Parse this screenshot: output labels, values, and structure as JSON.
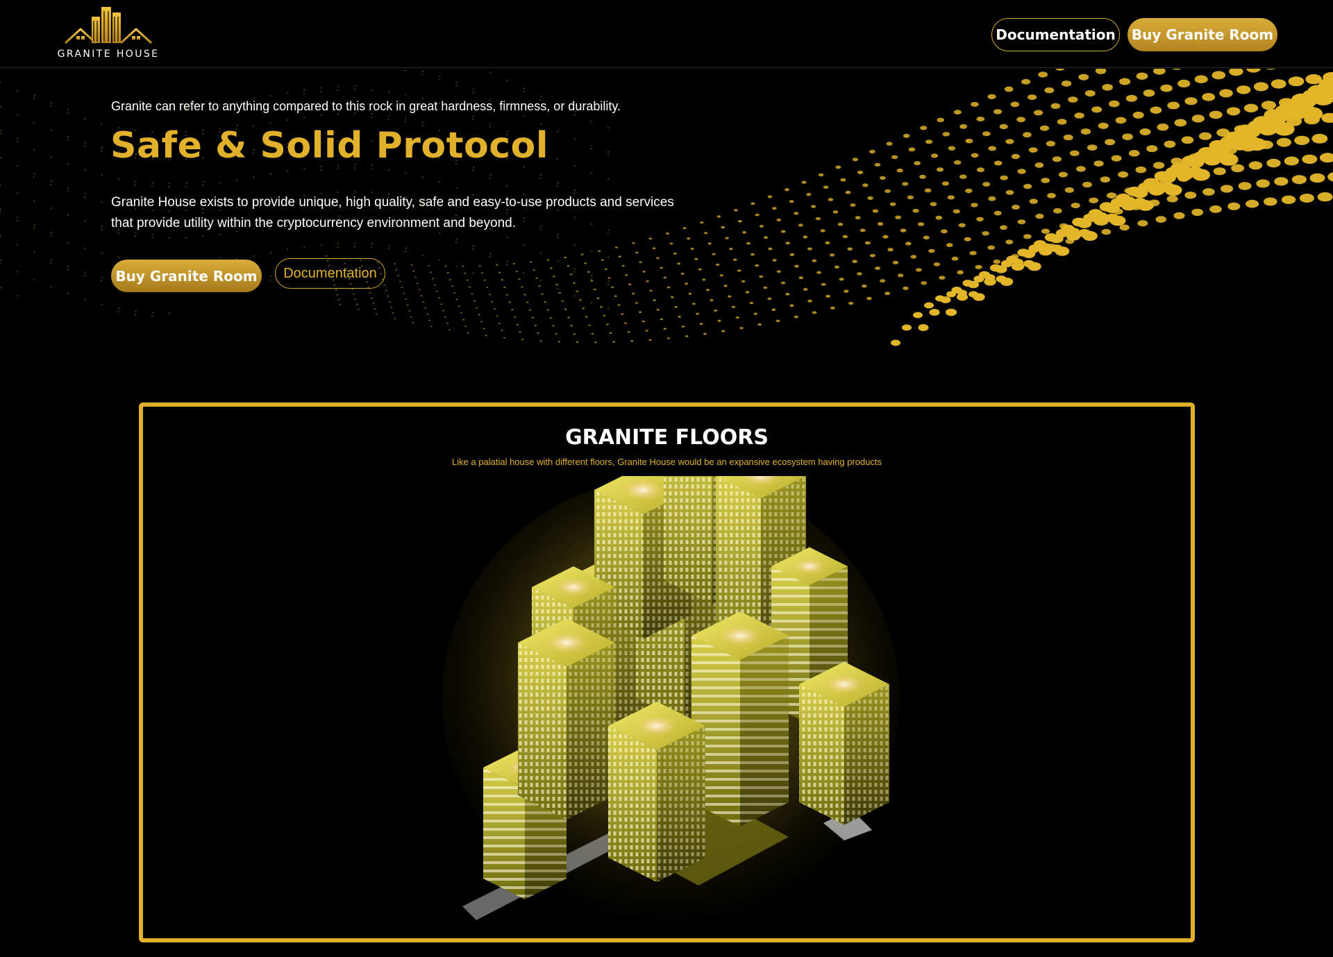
{
  "brand": {
    "name": "GRANITE HOUSE"
  },
  "nav": {
    "documentation_label": "Documentation",
    "buy_label": "Buy Granite Room"
  },
  "hero": {
    "tagline": "Granite can refer to anything compared to this rock in great hardness, firmness, or durability.",
    "headline": "Safe & Solid Protocol",
    "description": "Granite House exists to provide unique, high quality, safe and easy-to-use products and services that provide utility within the cryptocurrency environment and beyond.",
    "buy_label": "Buy Granite Room",
    "documentation_label": "Documentation"
  },
  "floors": {
    "title": "GRANITE FLOORS",
    "subtitle": "Like a palatial house with different floors, Granite House would be an expansive ecosystem having products"
  },
  "colors": {
    "accent": "#e2b12b",
    "background": "#000000",
    "text": "#ffffff"
  },
  "icons": {
    "logo": "building-house-icon",
    "hero_art": "dotted-wave-illustration",
    "city_art": "isometric-city-illustration"
  }
}
